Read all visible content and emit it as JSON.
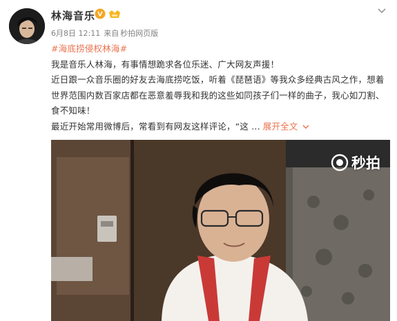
{
  "post": {
    "username": "林海音乐",
    "date": "6月8日 12:11",
    "source_prefix": "来自",
    "source": "秒拍网页版",
    "hashtag": "#海底捞侵权林海#",
    "paragraphs": [
      "我是音乐人林海，有事情想跪求各位乐迷、广大网友声援！",
      "近日跟一众音乐圈的好友去海底捞吃饭，听着《琵琶语》等我众多经典古风之作，想着世界范围内数百家店都在恶意羞辱我和我的这些如同孩子们一样的曲子，我心如刀割、食不知味！",
      "最近开始常用微博后，常看到有网友这样评论，“这 ..."
    ],
    "expand_label": "展开全文"
  },
  "video": {
    "watermark_text": "秒拍"
  },
  "icons": {
    "avatar": "avatar-portrait",
    "vip": "verified-v-badge",
    "level": "member-level-icon",
    "menu": "chevron-down-icon",
    "expand": "chevron-down-icon",
    "watermark": "miaopai-logo-icon"
  },
  "colors": {
    "link": "#eb7350",
    "text": "#333333",
    "meta": "#808080",
    "verified": "#f5a623"
  }
}
